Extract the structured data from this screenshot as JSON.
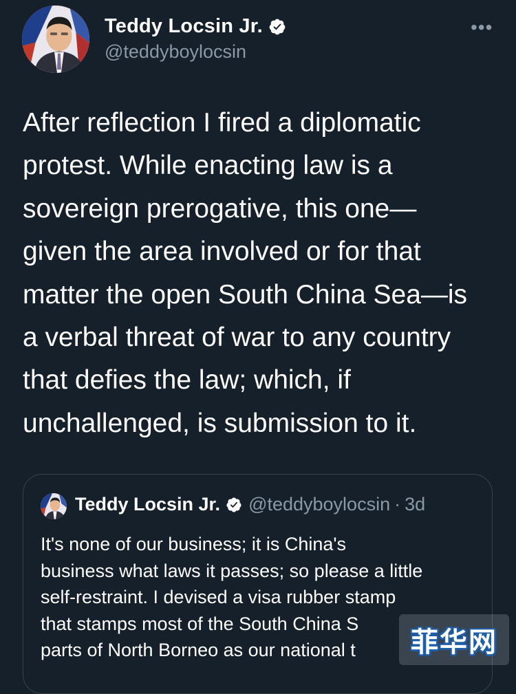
{
  "author": {
    "display_name": "Teddy Locsin Jr.",
    "handle": "@teddyboylocsin"
  },
  "more_label": "•••",
  "tweet": {
    "lines": [
      "After reflection I fired a diplomatic",
      "protest. While enacting law is a",
      "sovereign prerogative, this one—",
      "given the area involved or for that",
      "matter the open South China Sea—is",
      "a verbal threat of war to any country",
      "that defies the law; which, if",
      "unchallenged, is submission to it."
    ]
  },
  "quoted": {
    "display_name": "Teddy Locsin Jr.",
    "handle": "@teddyboylocsin",
    "separator": "·",
    "time": "3d",
    "lines": [
      "It's none of our business; it is China's",
      "business what laws it passes; so please a little",
      "self-restraint. I devised a visa rubber stamp",
      "that stamps most of the South China S",
      "parts of North Borneo as our national t"
    ]
  },
  "watermark": "菲华网",
  "colors": {
    "background": "#15202b",
    "secondary_text": "#8b98a5",
    "border": "#38444d",
    "verified_badge": "#ffffff"
  }
}
